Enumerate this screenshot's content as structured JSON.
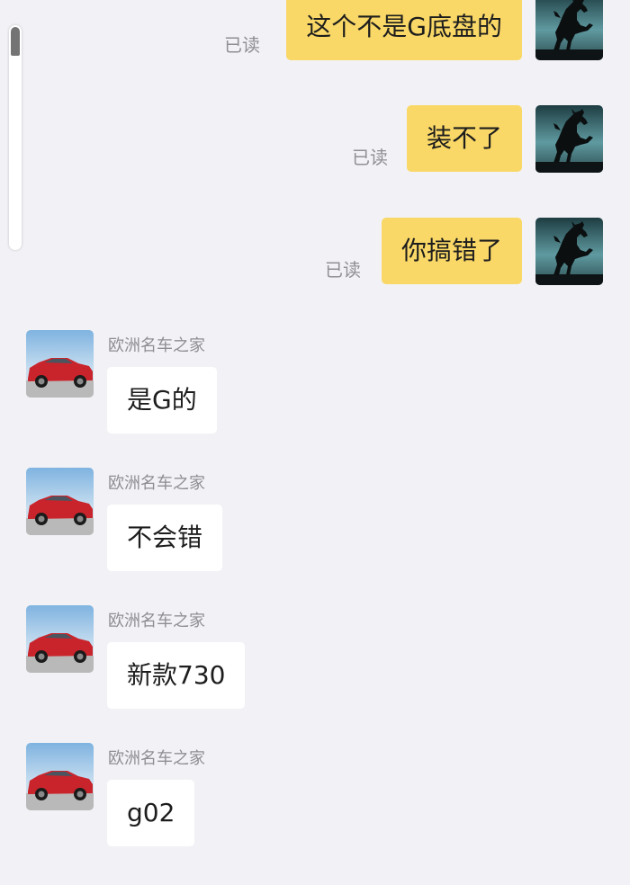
{
  "colors": {
    "bubble_me": "#f9d867",
    "bubble_them": "#ffffff",
    "background": "#f2f2f6"
  },
  "icons": {
    "my_avatar": "horse-avatar-icon",
    "their_avatar": "red-car-avatar-icon"
  },
  "sent_messages": [
    {
      "text": "这个不是G底盘的",
      "status": "已读"
    },
    {
      "text": "装不了",
      "status": "已读"
    },
    {
      "text": "你搞错了",
      "status": "已读"
    }
  ],
  "received_messages": [
    {
      "sender": "欧洲名车之家",
      "text": "是G的"
    },
    {
      "sender": "欧洲名车之家",
      "text": "不会错"
    },
    {
      "sender": "欧洲名车之家",
      "text": "新款730"
    },
    {
      "sender": "欧洲名车之家",
      "text": "g02"
    }
  ]
}
